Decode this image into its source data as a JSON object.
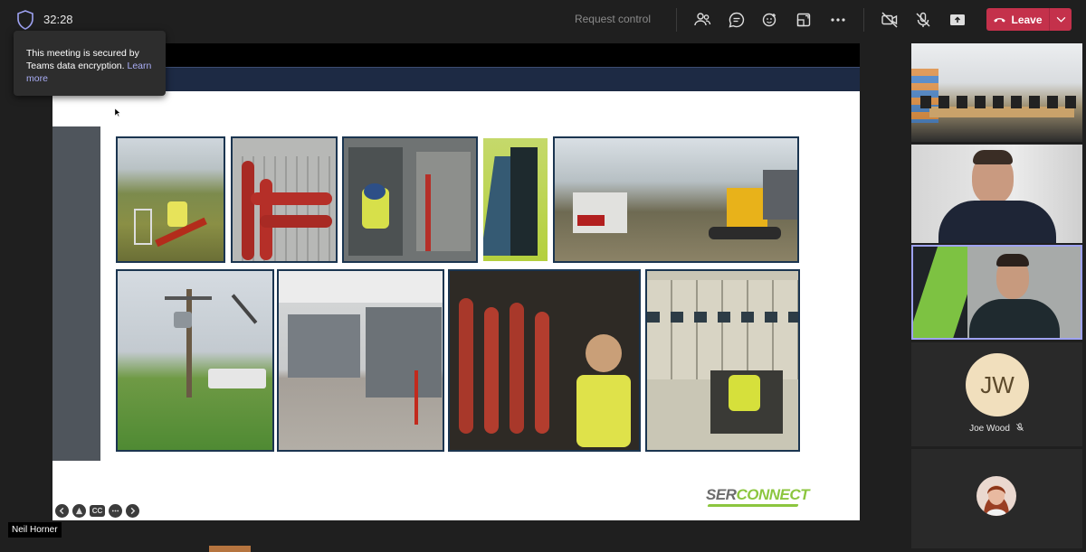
{
  "meeting": {
    "timer": "32:28",
    "request_control": "Request control",
    "leave_label": "Leave"
  },
  "tooltip": {
    "text": "This meeting is secured by Teams data encryption.",
    "link": "Learn more"
  },
  "toolbar_icons": [
    "people-icon",
    "chat-icon",
    "reactions-icon",
    "rooms-icon",
    "more-icon",
    "camera-off-icon",
    "mic-off-icon",
    "share-icon"
  ],
  "slide": {
    "logo_part1": "SER",
    "logo_part2": "CONNECT",
    "controls": {
      "cc": "CC"
    }
  },
  "presenter": {
    "name": "Neil Horner"
  },
  "participants": [
    {
      "name": "Joe Wood",
      "initials": "JW"
    }
  ],
  "colors": {
    "leave_red": "#c4314b",
    "slide_header": "#1d2a44",
    "brand_green": "#8cc63f",
    "active_speaker_border": "#9ea2f2"
  }
}
